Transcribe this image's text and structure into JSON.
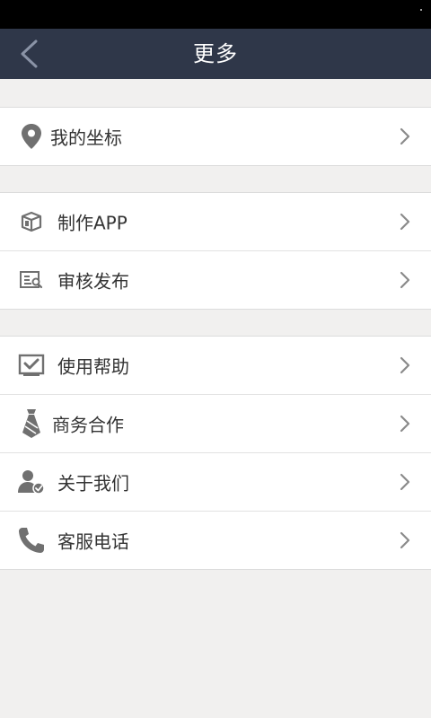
{
  "header": {
    "title": "更多",
    "back_icon": "chevron-left-icon"
  },
  "groups": [
    {
      "items": [
        {
          "label": "我的坐标",
          "icon": "location-pin-icon"
        }
      ]
    },
    {
      "items": [
        {
          "label": "制作APP",
          "icon": "box-icon"
        },
        {
          "label": "审核发布",
          "icon": "document-search-icon"
        }
      ]
    },
    {
      "items": [
        {
          "label": "使用帮助",
          "icon": "checkbox-help-icon"
        },
        {
          "label": "商务合作",
          "icon": "tie-icon"
        },
        {
          "label": "关于我们",
          "icon": "user-check-icon"
        },
        {
          "label": "客服电话",
          "icon": "phone-icon"
        }
      ]
    }
  ],
  "colors": {
    "nav_bg": "#2f3749",
    "page_bg": "#f1f0ef",
    "icon_gray": "#707070",
    "chevron_gray": "#8a8a8a"
  }
}
